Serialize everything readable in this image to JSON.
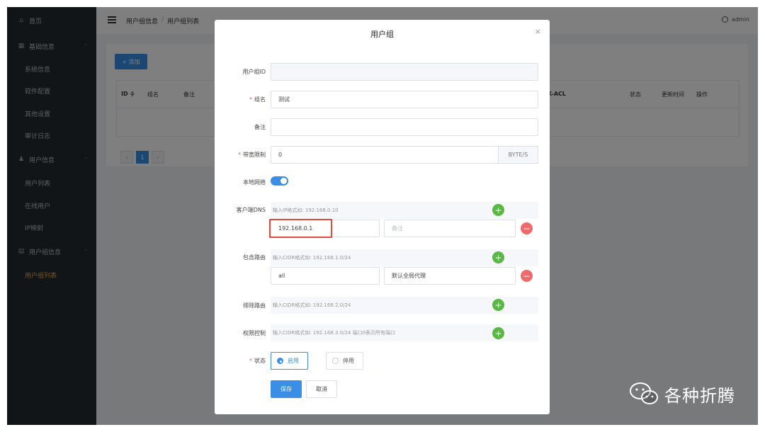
{
  "sidebar": {
    "items": [
      {
        "label": "首页",
        "type": "top"
      },
      {
        "label": "基础信息",
        "type": "group"
      },
      {
        "label": "系统信息",
        "type": "sub"
      },
      {
        "label": "软件配置",
        "type": "sub"
      },
      {
        "label": "其他设置",
        "type": "sub"
      },
      {
        "label": "审计日志",
        "type": "sub"
      },
      {
        "label": "用户信息",
        "type": "group"
      },
      {
        "label": "用户列表",
        "type": "sub"
      },
      {
        "label": "在线用户",
        "type": "sub"
      },
      {
        "label": "IP映射",
        "type": "sub"
      },
      {
        "label": "用户组信息",
        "type": "group"
      },
      {
        "label": "用户组列表",
        "type": "sub-active"
      }
    ]
  },
  "header": {
    "breadcrumb": [
      "用户组信息",
      "/",
      "用户组列表"
    ],
    "user": "admin"
  },
  "card": {
    "add_label": "+ 添加",
    "columns": [
      "ID ≑",
      "组名",
      "备注",
      "K-ACL",
      "状态",
      "更新时间",
      "操作"
    ],
    "page": "1",
    "prev": "‹",
    "next": "›"
  },
  "modal": {
    "title": "用户组",
    "close": "×",
    "labels": {
      "id": "用户组ID",
      "name": "组名",
      "remark": "备注",
      "bandwidth": "带宽限制",
      "local_net": "本地网络",
      "dns": "客户端DNS",
      "include_routes": "包含路由",
      "exclude_routes": "排除路由",
      "acl": "权限控制",
      "status": "状态"
    },
    "required_mark": "*",
    "values": {
      "id": "",
      "name": "测试",
      "remark": "",
      "bandwidth": "0",
      "bandwidth_unit": "BYTE/S"
    },
    "dns": {
      "placeholder": "输入IP格式如: 192.168.0.10",
      "entry_value": "192.168.0.1",
      "entry_note_placeholder": "备注"
    },
    "include": {
      "placeholder": "输入CIDR格式如: 192.168.1.0/24",
      "entry_value": "all",
      "entry_note": "默认全局代理"
    },
    "exclude": {
      "placeholder": "输入CIDR格式如: 192.168.2.0/24"
    },
    "acl": {
      "placeholder": "输入CIDR格式如: 192.168.3.0/24 端口0表示所有端口"
    },
    "status_options": [
      "启用",
      "停用"
    ],
    "status_selected": "启用",
    "local_net_on": true,
    "save": "保存",
    "cancel": "取消",
    "plus": "+",
    "minus": "−"
  },
  "watermark": "各种折腾",
  "colors": {
    "primary": "#3a8ee6",
    "sidebar_bg": "#232a31",
    "active": "#f0a93a",
    "add": "#59b845",
    "remove": "#ef6a6a",
    "highlight": "#e04b3b"
  }
}
